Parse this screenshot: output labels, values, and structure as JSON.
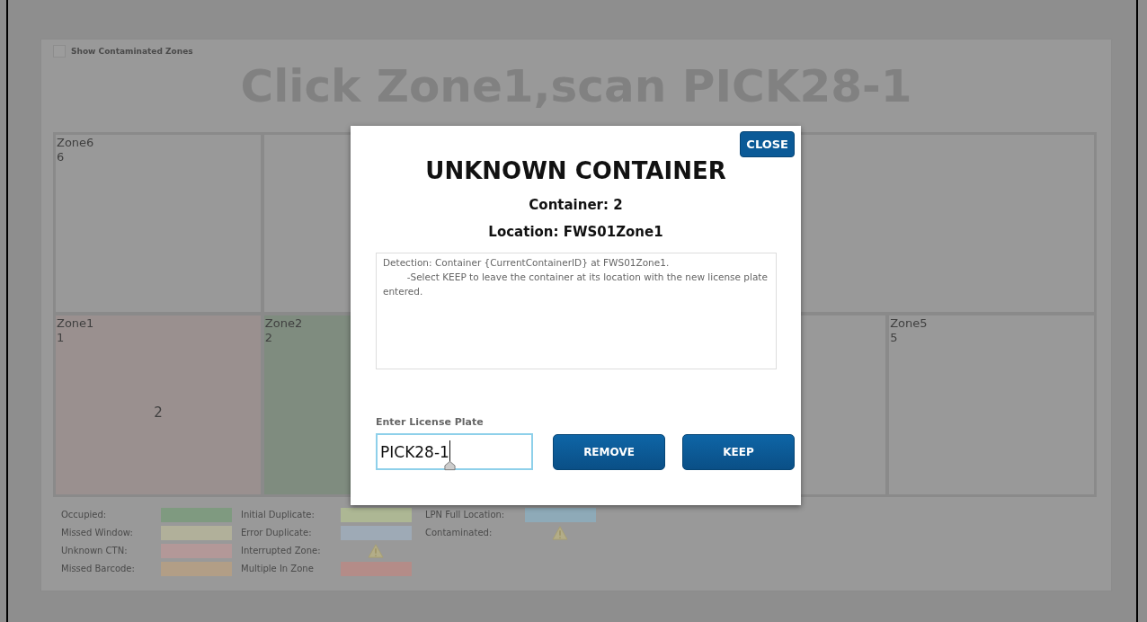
{
  "contaminated_toggle": {
    "label": "Show Contaminated Zones",
    "checked": false
  },
  "instruction": "Click Zone1,scan PICK28-1",
  "zone_rows": [
    {
      "cells": [
        {
          "kind": "zone",
          "name": "Zone6",
          "number": "6"
        },
        {
          "kind": "empty"
        },
        {
          "kind": "wide"
        }
      ]
    },
    {
      "cells": [
        {
          "kind": "zone",
          "name": "Zone1",
          "number": "1",
          "color": "#9a908f",
          "content": "2"
        },
        {
          "kind": "zone",
          "name": "Zone2",
          "number": "2",
          "color": "#7f8c7f"
        },
        {
          "kind": "double"
        },
        {
          "kind": "zone",
          "name": "Zone5",
          "number": "5"
        }
      ]
    }
  ],
  "legend": [
    {
      "label": "Occupied:",
      "kind": "swatch",
      "color": "#7f9a80"
    },
    {
      "label": "Missed Window:",
      "kind": "swatch",
      "color": "#b1b09a"
    },
    {
      "label": "Unknown CTN:",
      "kind": "swatch",
      "color": "#b39898"
    },
    {
      "label": "Missed Barcode:",
      "kind": "swatch",
      "color": "#b29e86"
    },
    {
      "label": "Initial Duplicate:",
      "kind": "swatch",
      "color": "#adb794"
    },
    {
      "label": "Error Duplicate:",
      "kind": "swatch",
      "color": "#9eaab6"
    },
    {
      "label": "Interrupted Zone:",
      "kind": "warning"
    },
    {
      "label": "Multiple In Zone",
      "kind": "swatch",
      "color": "#b48c88"
    },
    {
      "label": "LPN Full Location:",
      "kind": "swatch",
      "color": "#8eaab8"
    },
    {
      "label": "Contaminated:",
      "kind": "warning"
    }
  ],
  "dialog": {
    "close": "CLOSE",
    "title": "UNKNOWN CONTAINER",
    "container": "Container: 2",
    "location": "Location: FWS01Zone1",
    "message": "Detection: Container {CurrentContainerID} at FWS01Zone1.\n        -Select KEEP to leave the container at its location with the new license plate entered.",
    "plate_label": "Enter License Plate",
    "plate_value": "PICK28-1",
    "buttons": [
      "REMOVE",
      "KEEP"
    ]
  }
}
